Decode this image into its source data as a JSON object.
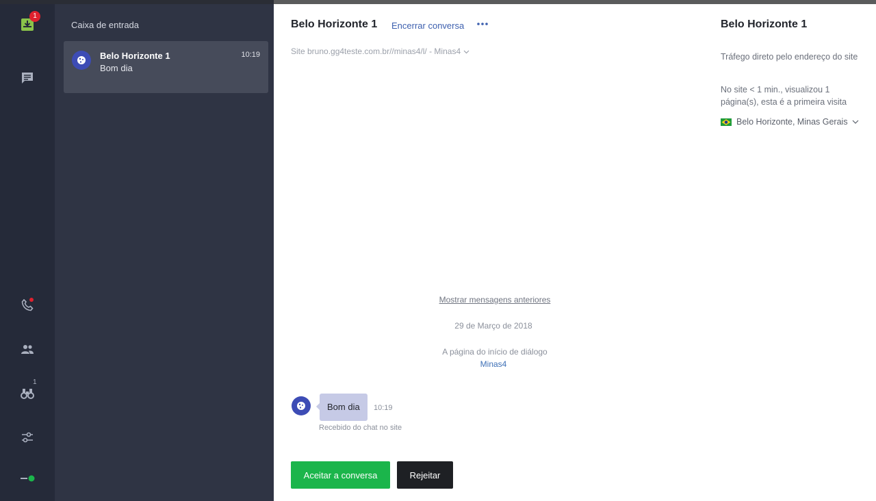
{
  "rail": {
    "inbox_badge": "1",
    "watch_count": "1"
  },
  "inbox": {
    "title": "Caixa de entrada",
    "conversation": {
      "name": "Belo Horizonte 1",
      "time": "10:19",
      "preview": "Bom dia"
    }
  },
  "chat": {
    "title": "Belo Horizonte 1",
    "end_label": "Encerrar conversa",
    "site_line": "Site bruno.gg4teste.com.br//minas4/l/ - Minas4",
    "show_previous": "Mostrar mensagens anteriores",
    "date": "29 de Março de 2018",
    "dialog_start_label": "A página do início de diálogo",
    "dialog_start_link": "Minas4",
    "message": {
      "text": "Bom dia",
      "time": "10:19",
      "source": "Recebido do chat no site"
    },
    "accept_label": "Aceitar a conversa",
    "reject_label": "Rejeitar"
  },
  "info": {
    "title": "Belo Horizonte 1",
    "traffic": "Tráfego direto pelo endereço do site",
    "visit": "No site < 1 min., visualizou 1 página(s), esta é a primeira visita",
    "location": "Belo Horizonte, Minas Gerais"
  },
  "colors": {
    "accent_green": "#1bb54b",
    "link_blue": "#3c5fae",
    "avatar_blue": "#3d4cb5",
    "badge_red": "#e0212e"
  }
}
